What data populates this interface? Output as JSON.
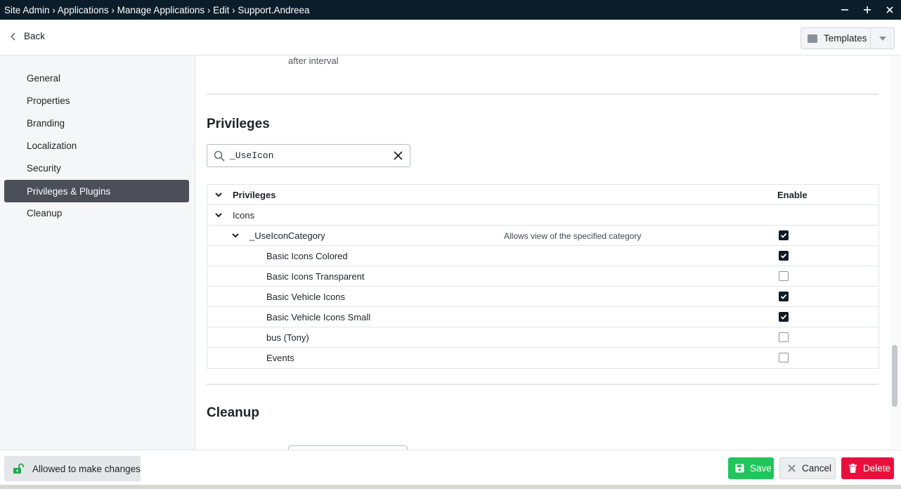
{
  "titlebar": {
    "breadcrumb": "Site Admin › Applications › Manage Applications › Edit › Support.Andreea",
    "controls": [
      "minimize-icon",
      "maximize-icon",
      "close-icon"
    ]
  },
  "toolbar": {
    "back_label": "Back",
    "templates_label": "Templates"
  },
  "sidebar": {
    "items": [
      {
        "label": "General",
        "active": false
      },
      {
        "label": "Properties",
        "active": false
      },
      {
        "label": "Branding",
        "active": false
      },
      {
        "label": "Localization",
        "active": false
      },
      {
        "label": "Security",
        "active": false
      },
      {
        "label": "Privileges & Plugins",
        "active": true
      },
      {
        "label": "Cleanup",
        "active": false
      }
    ]
  },
  "main": {
    "previous_text": "after interval",
    "privileges": {
      "title": "Privileges",
      "search_value": "_UseIcon",
      "table": {
        "header_label": "Privileges",
        "enable_label": "Enable",
        "group": "Icons",
        "category": {
          "label": "_UseIconCategory",
          "description": "Allows view of the specified category",
          "checked": true
        },
        "items": [
          {
            "label": "Basic Icons Colored",
            "checked": true
          },
          {
            "label": "Basic Icons Transparent",
            "checked": false
          },
          {
            "label": "Basic Vehicle Icons",
            "checked": true
          },
          {
            "label": "Basic Vehicle Icons Small",
            "checked": true
          },
          {
            "label": "bus (Tony)",
            "checked": false
          },
          {
            "label": "Events",
            "checked": false
          }
        ]
      }
    },
    "cleanup": {
      "title": "Cleanup"
    }
  },
  "footer": {
    "status_label": "Allowed to make changes",
    "save_label": "Save",
    "cancel_label": "Cancel",
    "delete_label": "Delete"
  },
  "colors": {
    "titlebar": "#0b1d2a",
    "active_nav": "#4a4f58",
    "save": "#20c55b",
    "delete": "#e8103b",
    "checkbox_checked": "#0f1b26"
  }
}
